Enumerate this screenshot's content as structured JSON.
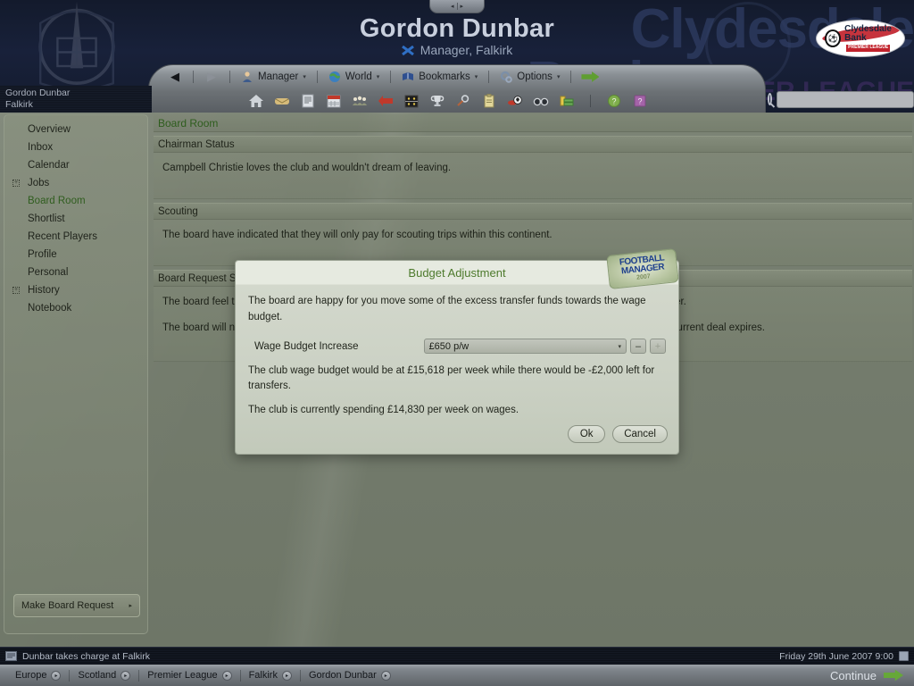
{
  "window": {
    "page_nav_prev": "◂",
    "page_nav_next": "▸"
  },
  "header": {
    "title": "Gordon Dunbar",
    "subtitle": "Manager, Falkirk",
    "flag_icon": "scotland-saltire-icon",
    "crest_icon": "falkirk-club-crest-icon",
    "sponsor": {
      "line1": "Clydesdale",
      "line2": "Bank",
      "badge": "PREMIER LEAGUE",
      "watermark_line1": "Clydesdale",
      "watermark_line2": "Bank",
      "watermark_badge": "PREMIER LEAGUE"
    }
  },
  "user_strip": {
    "name": "Gordon Dunbar",
    "club": "Falkirk"
  },
  "toolbar": {
    "back_arrow": "◀",
    "forward_arrow": "▶",
    "menus": [
      {
        "label": "Manager",
        "icon": "manager-person-icon",
        "caret": "▾"
      },
      {
        "label": "World",
        "icon": "world-globe-icon",
        "caret": "▾"
      },
      {
        "label": "Bookmarks",
        "icon": "bookmarks-book-icon",
        "caret": "▾"
      },
      {
        "label": "Options",
        "icon": "options-gears-icon",
        "caret": "▾"
      }
    ],
    "go_icon": "green-arrow-go-icon",
    "icons": [
      "home-icon",
      "inbox-envelope-icon",
      "news-paper-icon",
      "calendar-icon",
      "squad-players-icon",
      "transfers-arrow-icon",
      "tactics-board-icon",
      "competitions-trophy-icon",
      "scouting-magnifier-icon",
      "clipboard-icon",
      "training-ball-icon",
      "binoculars-icon",
      "finances-money-icon"
    ],
    "help_icons": [
      "help-question-green-icon",
      "help-question-purple-icon"
    ]
  },
  "search": {
    "icon": "search-magnifier-icon",
    "value": "",
    "placeholder": ""
  },
  "sidebar": {
    "items": [
      {
        "label": "Overview",
        "expandable": false,
        "selected": false
      },
      {
        "label": "Inbox",
        "expandable": false,
        "selected": false
      },
      {
        "label": "Calendar",
        "expandable": false,
        "selected": false
      },
      {
        "label": "Jobs",
        "expandable": true,
        "selected": false
      },
      {
        "label": "Board Room",
        "expandable": false,
        "selected": true
      },
      {
        "label": "Shortlist",
        "expandable": false,
        "selected": false
      },
      {
        "label": "Recent Players",
        "expandable": false,
        "selected": false
      },
      {
        "label": "Profile",
        "expandable": false,
        "selected": false
      },
      {
        "label": "Personal",
        "expandable": false,
        "selected": false
      },
      {
        "label": "History",
        "expandable": true,
        "selected": false
      },
      {
        "label": "Notebook",
        "expandable": false,
        "selected": false
      }
    ],
    "action_button": {
      "label": "Make Board Request",
      "arrow": "▸"
    }
  },
  "main": {
    "page_title": "Board Room",
    "panels": [
      {
        "heading": "Chairman Status",
        "lines": [
          "Campbell Christie loves the club and wouldn't dream of leaving."
        ]
      },
      {
        "heading": "Scouting",
        "lines": [
          "The board have indicated that they will only pay for scouting trips within this continent."
        ]
      },
      {
        "heading": "Board Request Status",
        "lines": [
          "The board feel that a club of our stature should not be a feeder club to another team and will not discuss the matter.",
          "The board will not enter into talks regarding a new contract as there is still a significant amount of time until your current deal expires."
        ]
      }
    ]
  },
  "dialog": {
    "title": "Budget Adjustment",
    "logo": {
      "line1": "FOOTBALL",
      "line2": "MANAGER",
      "line3": "2007"
    },
    "intro": "The board are happy for you move some of the excess transfer funds towards the wage budget.",
    "field_label": "Wage Budget Increase",
    "field_value": "£650 p/w",
    "field_caret": "▾",
    "decrement_label": "–",
    "increment_label": "+",
    "summary": "The club wage budget would be at £15,618 per week while there would be -£2,000 left for transfers.",
    "spending": "The club is currently spending £14,830 per week on wages.",
    "ok_label": "Ok",
    "cancel_label": "Cancel"
  },
  "status_bar": {
    "news_icon": "newspaper-icon",
    "news_text": "Dunbar takes charge at Falkirk",
    "date": "Friday 29th June 2007 9:00",
    "date_icon": "calendar-book-icon"
  },
  "breadcrumb": {
    "items": [
      "Europe",
      "Scotland",
      "Premier League",
      "Falkirk",
      "Gordon Dunbar"
    ],
    "dot": "▸",
    "continue_label": "Continue",
    "continue_icon": "green-arrow-continue-icon"
  },
  "colors": {
    "accent_green": "#2f5d1e",
    "dialog_title_green": "#4d7a2c",
    "header_navy": "#18213a",
    "body_olive": "#747c6d",
    "sponsor_red": "#c1232c",
    "continue_green": "#66a838"
  }
}
